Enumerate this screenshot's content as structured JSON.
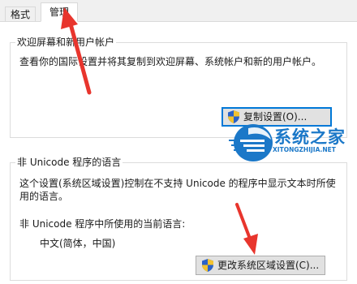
{
  "tabs": [
    {
      "label": "格式",
      "active": false
    },
    {
      "label": "管理",
      "active": true
    }
  ],
  "welcome_group": {
    "title": "欢迎屏幕和新用户帐户",
    "description": "查看你的国际设置并将其复制到欢迎屏幕、系统帐户和新的用户帐户。",
    "copy_button_label": "复制设置(O)..."
  },
  "unicode_group": {
    "title": "非 Unicode 程序的语言",
    "description_line1": "这个设置(系统区域设置)控制在不支持 Unicode 的程序中显示文本时所使",
    "description_line2": "用的语言。",
    "current_label": "非 Unicode 程序中所使用的当前语言:",
    "current_value": "中文(简体，中国)",
    "change_button_label": "更改系统区域设置(C)..."
  },
  "watermark": {
    "brand": "系统之家",
    "url": "XITONGZHIJIA.NET",
    "color": "#1b78c8"
  },
  "annotation_arrow_color": "#e8352d",
  "shield_icon": "uac-shield-icon"
}
